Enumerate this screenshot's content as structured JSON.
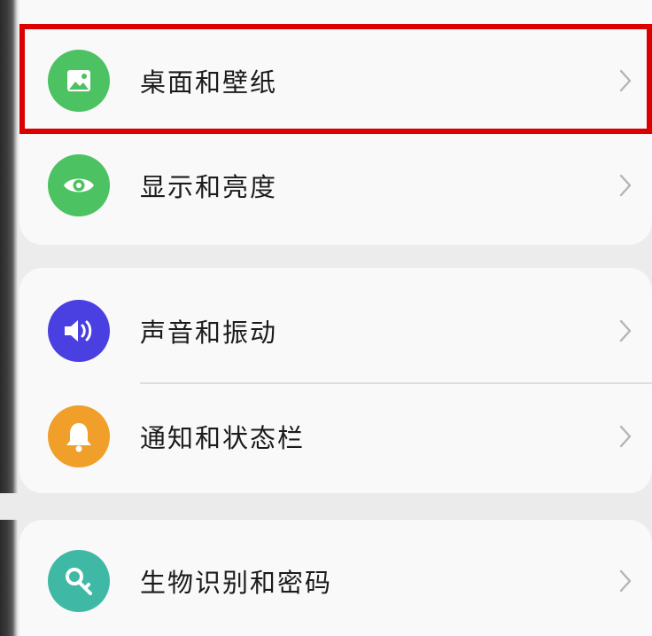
{
  "settings": {
    "items": [
      {
        "label": "桌面和壁纸",
        "icon": "wallpaper-icon",
        "color": "#4cc262"
      },
      {
        "label": "显示和亮度",
        "icon": "eye-icon",
        "color": "#4cc262"
      },
      {
        "label": "声音和振动",
        "icon": "speaker-icon",
        "color": "#4a3fe0"
      },
      {
        "label": "通知和状态栏",
        "icon": "bell-icon",
        "color": "#f0a02a"
      },
      {
        "label": "生物识别和密码",
        "icon": "key-icon",
        "color": "#3fb9a5"
      }
    ]
  },
  "highlight_color": "#dc0000"
}
